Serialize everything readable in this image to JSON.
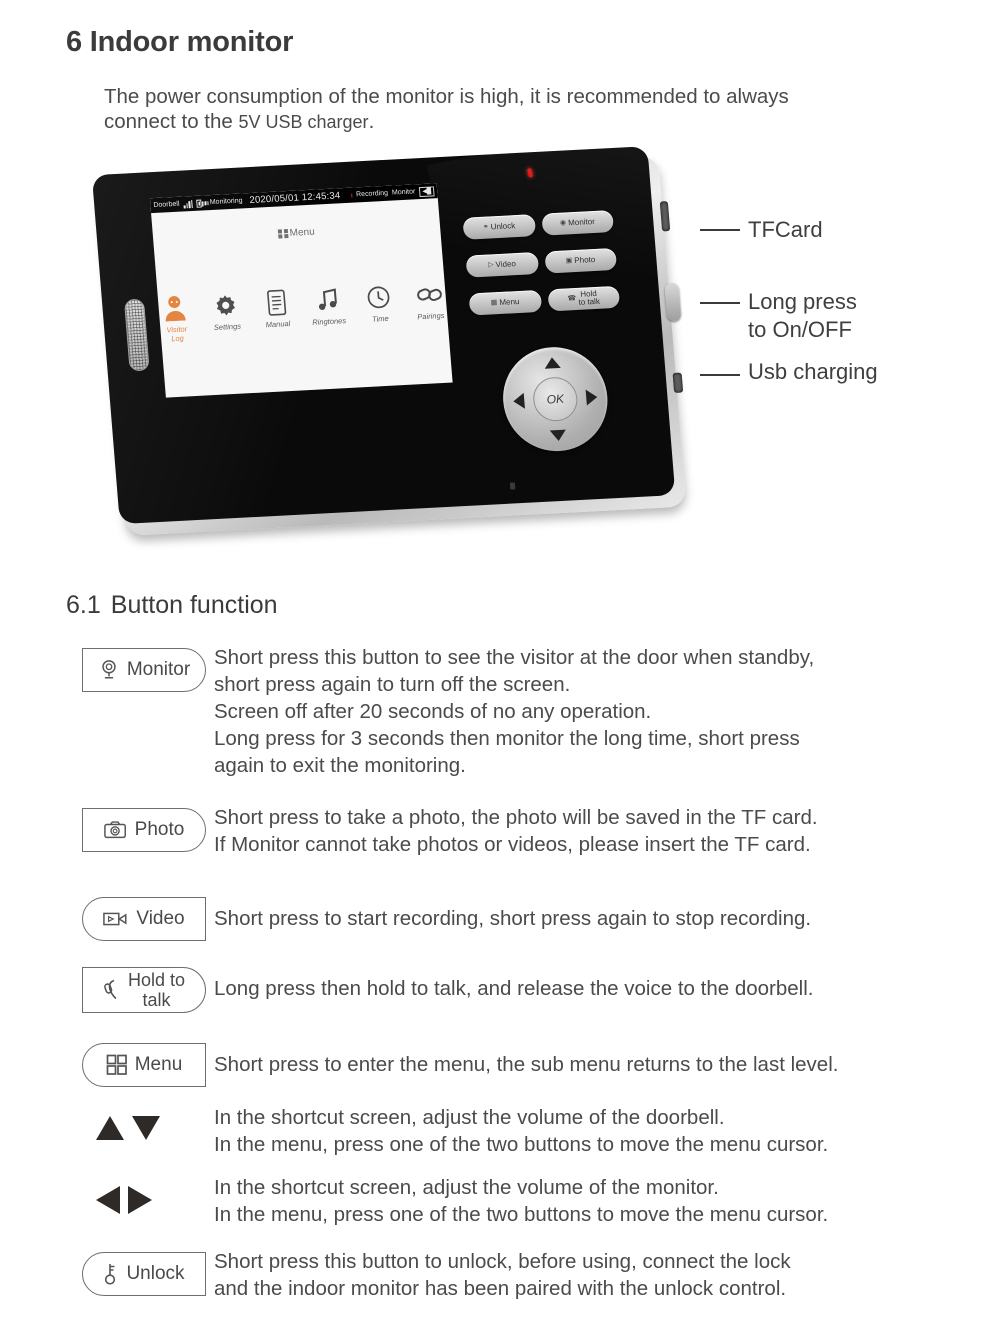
{
  "section": {
    "number": "6",
    "title": "6 Indoor monitor",
    "intro_line1": "The power consumption of the monitor is high, it is recommended to always",
    "intro_line2_a": "connect to the ",
    "intro_line2_small": "5V USB",
    "intro_line2_b": " charger",
    "intro_line2_end": "."
  },
  "device": {
    "screen": {
      "statusbar": {
        "label": "Doorbell",
        "signal_icon": "signal-bars-icon",
        "battery_icon": "battery-icon",
        "monitoring": "Monitoring",
        "datetime": "2020/05/01  12:45:34",
        "recording": "Recording",
        "monitor": "Monitor",
        "sd_icon": "sd-card-icon"
      },
      "menu_title": "Menu",
      "menu_items": [
        {
          "label": "Visitor Log",
          "icon": "visitor-log-icon",
          "active": true
        },
        {
          "label": "Settings",
          "icon": "gear-icon",
          "active": false
        },
        {
          "label": "Manual",
          "icon": "manual-document-icon",
          "active": false
        },
        {
          "label": "Ringtones",
          "icon": "music-note-icon",
          "active": false
        },
        {
          "label": "Time",
          "icon": "clock-icon",
          "active": false
        },
        {
          "label": "Pairings",
          "icon": "chain-link-icon",
          "active": false
        }
      ]
    },
    "keys": [
      {
        "label": "Unlock",
        "icon": "key-icon"
      },
      {
        "label": "Monitor",
        "icon": "camera-lens-icon"
      },
      {
        "label": "Video",
        "icon": "camcorder-icon"
      },
      {
        "label": "Photo",
        "icon": "camera-icon"
      },
      {
        "label": "Menu",
        "icon": "grid-icon"
      },
      {
        "label": "Hold to talk",
        "label_line1": "Hold",
        "label_line2": "to talk",
        "icon": "handset-icon"
      }
    ],
    "dpad": {
      "ok": "OK",
      "up": "up-arrow",
      "down": "down-arrow",
      "left": "left-arrow",
      "right": "right-arrow"
    },
    "callouts": [
      {
        "label": "TFCard"
      },
      {
        "label_line1": "Long press",
        "label_line2": "to On/OFF"
      },
      {
        "label": "Usb charging"
      }
    ]
  },
  "button_function": {
    "heading_number": "6.1",
    "heading_text": "Button function",
    "rows": [
      {
        "button": "Monitor",
        "icon": "camera-lens-icon",
        "lines": [
          "Short press this button to see the visitor at the door when standby,",
          "short press again to turn off  the screen.",
          "Screen off after 20 seconds of no any operation.",
          "Long press for 3 seconds then monitor the long time, short press",
          "again to exit the monitoring."
        ]
      },
      {
        "button": "Photo",
        "icon": "camera-icon",
        "lines": [
          "Short press to take a photo, the photo will be saved in the TF card.",
          "If Monitor cannot take photos or videos, please insert the TF card."
        ]
      },
      {
        "button": "Video",
        "icon": "camcorder-icon",
        "lines": [
          "Short press to start recording,  short press again to stop recording."
        ]
      },
      {
        "button": "Hold to talk",
        "button_line1": "Hold to",
        "button_line2": "talk",
        "icon": "handset-icon",
        "lines": [
          "Long  press then hold to talk, and release the voice to the doorbell."
        ]
      },
      {
        "button": "Menu",
        "icon": "grid-icon",
        "lines": [
          "Short press to enter the menu, the sub menu returns to the last level."
        ]
      },
      {
        "button": "up-down-arrows",
        "icon": "up-down-arrow-icon",
        "lines": [
          "In the shortcut screen, adjust the volume of the doorbell.",
          "In the menu, press one of the two buttons to move the menu cursor."
        ]
      },
      {
        "button": "left-right-arrows",
        "icon": "left-right-arrow-icon",
        "lines": [
          "In the shortcut screen, adjust the volume of the monitor.",
          "In the menu, press one of the two buttons to move the menu cursor."
        ]
      },
      {
        "button": "Unlock",
        "icon": "key-icon",
        "lines": [
          "Short press this button to unlock, before using, connect the lock",
          "and the indoor monitor has been paired with the unlock control."
        ]
      }
    ]
  },
  "colors": {
    "heading": "#3b3b3b",
    "body_text": "#4b4b4b",
    "accent_orange": "#e4803a",
    "led_red": "#e21b1b",
    "chip_border": "#6e6e6e"
  }
}
